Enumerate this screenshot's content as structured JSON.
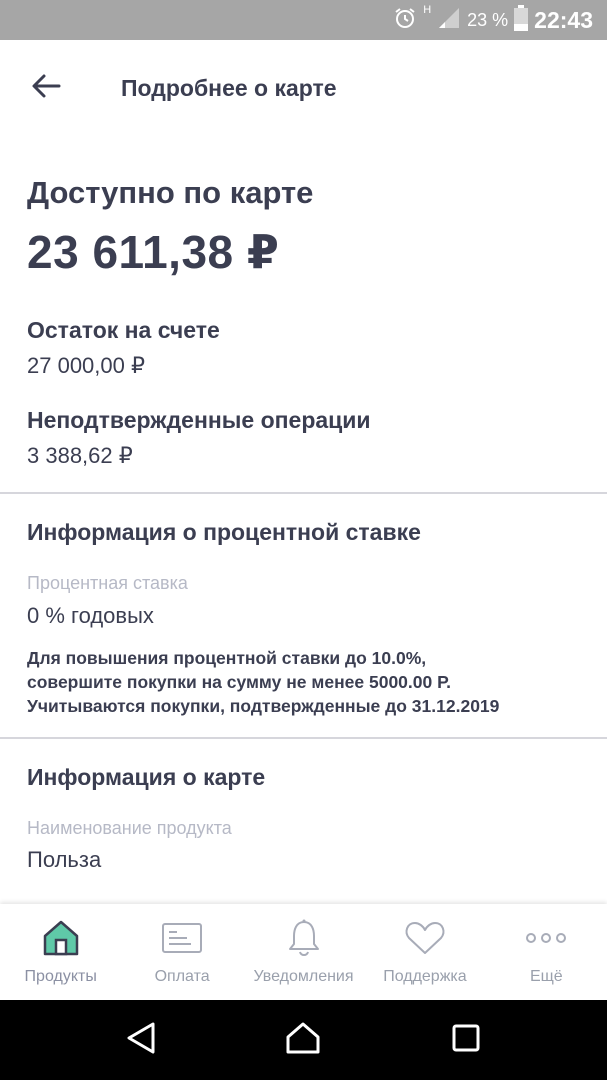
{
  "status_bar": {
    "network": "H",
    "battery": "23 %",
    "time": "22:43"
  },
  "header": {
    "title": "Подробнее о карте"
  },
  "balance": {
    "available_label": "Доступно по карте",
    "available_value": "23 611,38 ₽",
    "account_label": "Остаток на счете",
    "account_value": "27 000,00 ₽",
    "pending_label": "Неподтвержденные операции",
    "pending_value": "3 388,62 ₽"
  },
  "interest": {
    "section_title": "Информация о процентной ставке",
    "rate_label": "Процентная ставка",
    "rate_value": "0 % годовых",
    "note_lines": [
      "Для повышения процентной ставки до 10.0%,",
      "совершите  покупки  на сумму не менее 5000.00 Р.",
      "Учитываются покупки, подтвержденные до 31.12.2019"
    ]
  },
  "card_info": {
    "section_title": "Информация о карте",
    "product_label": "Наименование продукта",
    "product_value": "Польза"
  },
  "bottom_nav": {
    "items": [
      {
        "label": "Продукты",
        "icon": "home-icon",
        "active": true
      },
      {
        "label": "Оплата",
        "icon": "card-icon",
        "active": false
      },
      {
        "label": "Уведомления",
        "icon": "bell-icon",
        "active": false
      },
      {
        "label": "Поддержка",
        "icon": "heart-icon",
        "active": false
      },
      {
        "label": "Ещё",
        "icon": "more-dots-icon",
        "active": false
      }
    ]
  },
  "colors": {
    "accent": "#5fc9a8",
    "text": "#3b3e51",
    "muted": "#b6b9c6"
  }
}
